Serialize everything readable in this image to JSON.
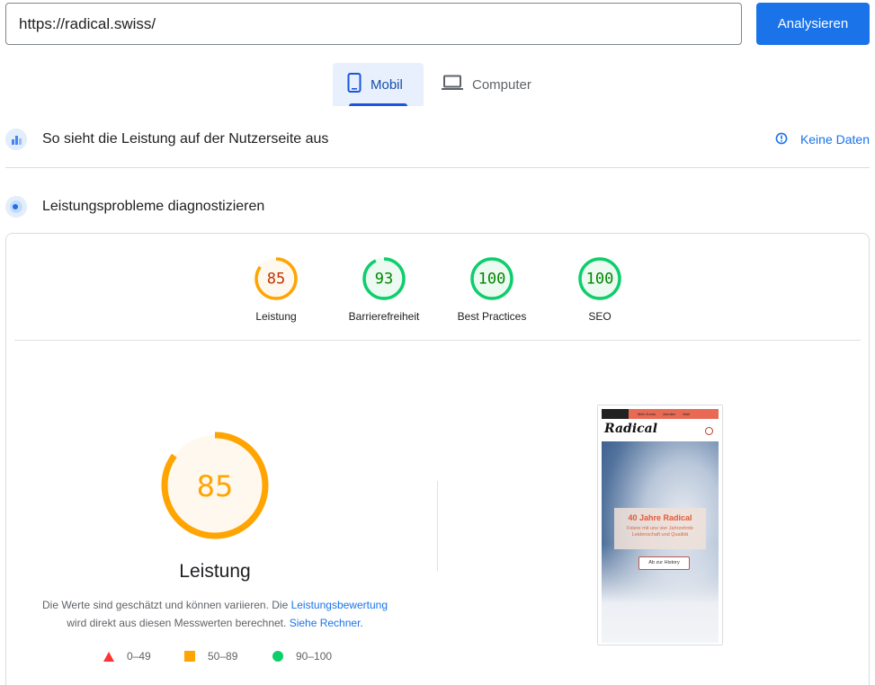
{
  "url_bar": {
    "value": "https://radical.swiss/"
  },
  "analyze_button": {
    "label": "Analysieren"
  },
  "tabs": [
    {
      "label": "Mobil",
      "active": true,
      "icon": "phone-icon"
    },
    {
      "label": "Computer",
      "active": false,
      "icon": "laptop-icon"
    }
  ],
  "field_data": {
    "title": "So sieht die Leistung auf der Nutzerseite aus",
    "status_label": "Keine Daten",
    "status_icon": "info-icon"
  },
  "diagnose": {
    "title": "Leistungsprobleme diagnostizieren"
  },
  "scores": [
    {
      "label": "Leistung",
      "value": "85",
      "score": 85,
      "color": "#ffa400",
      "text_color": "#c33300",
      "bg": "#fff8ef"
    },
    {
      "label": "Barrierefreiheit",
      "value": "93",
      "score": 93,
      "color": "#0cce6b",
      "text_color": "#008800",
      "bg": "#ecfaf2"
    },
    {
      "label": "Best Practices",
      "value": "100",
      "score": 100,
      "color": "#0cce6b",
      "text_color": "#008800",
      "bg": "#ecfaf2"
    },
    {
      "label": "SEO",
      "value": "100",
      "score": 100,
      "color": "#0cce6b",
      "text_color": "#008800",
      "bg": "#ecfaf2"
    }
  ],
  "performance": {
    "score": "85",
    "score_value": 85,
    "title": "Leistung",
    "desc_part1": "Die Werte sind geschätzt und können variieren. Die ",
    "link1": "Leistungsbewertung",
    "desc_part2": "wird direkt aus diesen Messwerten berechnet. ",
    "link2": "Siehe Rechner",
    "desc_end": "."
  },
  "legend": [
    {
      "range": "0–49",
      "shape": "triangle",
      "color": "#ff3333"
    },
    {
      "range": "50–89",
      "shape": "square",
      "color": "#ffa400"
    },
    {
      "range": "90–100",
      "shape": "circle",
      "color": "#0cce6b"
    }
  ],
  "screenshot": {
    "nav_items": [
      "Mein Konto",
      "Anrufen",
      "Mail"
    ],
    "brand": "Radical",
    "headline": "40 Jahre Radical",
    "subline": "Feiere mit uns vier Jahrzehnte Leidenschaft und Qualität",
    "button": "Ab zur History"
  }
}
